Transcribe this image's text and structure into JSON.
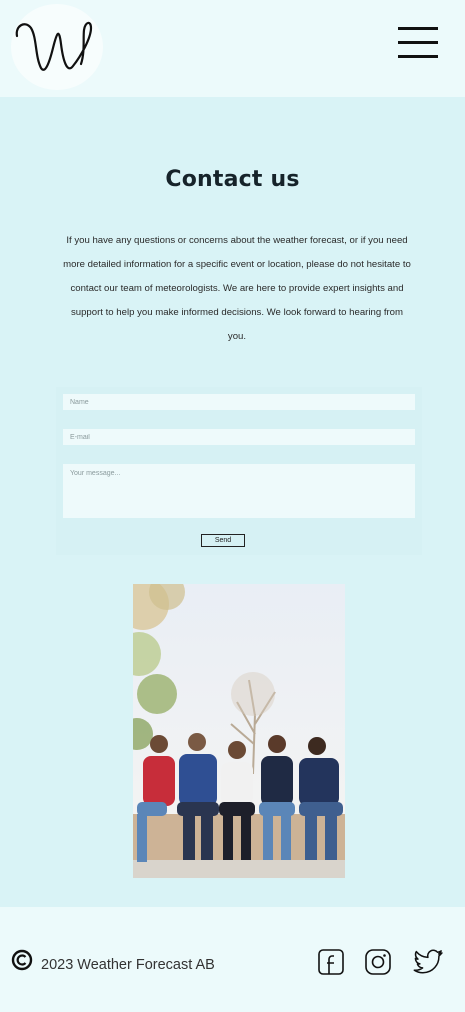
{
  "header": {
    "logo_text": "W",
    "menu_icon": "hamburger-menu-icon"
  },
  "contact": {
    "title": "Contact us",
    "intro": "If you have any questions or concerns about the weather forecast, or if you need more detailed information for a specific event or location, please do not hesitate to contact our team of meteorologists. We are here to provide expert insights and support to help you make informed decisions. We look forward to hearing from you."
  },
  "form": {
    "name_placeholder": "Name",
    "email_placeholder": "E-mail",
    "message_placeholder": "Your message...",
    "send_label": "Send"
  },
  "footer": {
    "copyright_icon": "copyright-icon",
    "copyright_text": "2023 Weather Forecast AB",
    "social": [
      "facebook-icon",
      "instagram-icon",
      "twitter-icon"
    ]
  },
  "colors": {
    "background": "#d9f3f6",
    "header_footer": "#ecfafb",
    "field": "#eefafb",
    "text": "#16232a"
  }
}
